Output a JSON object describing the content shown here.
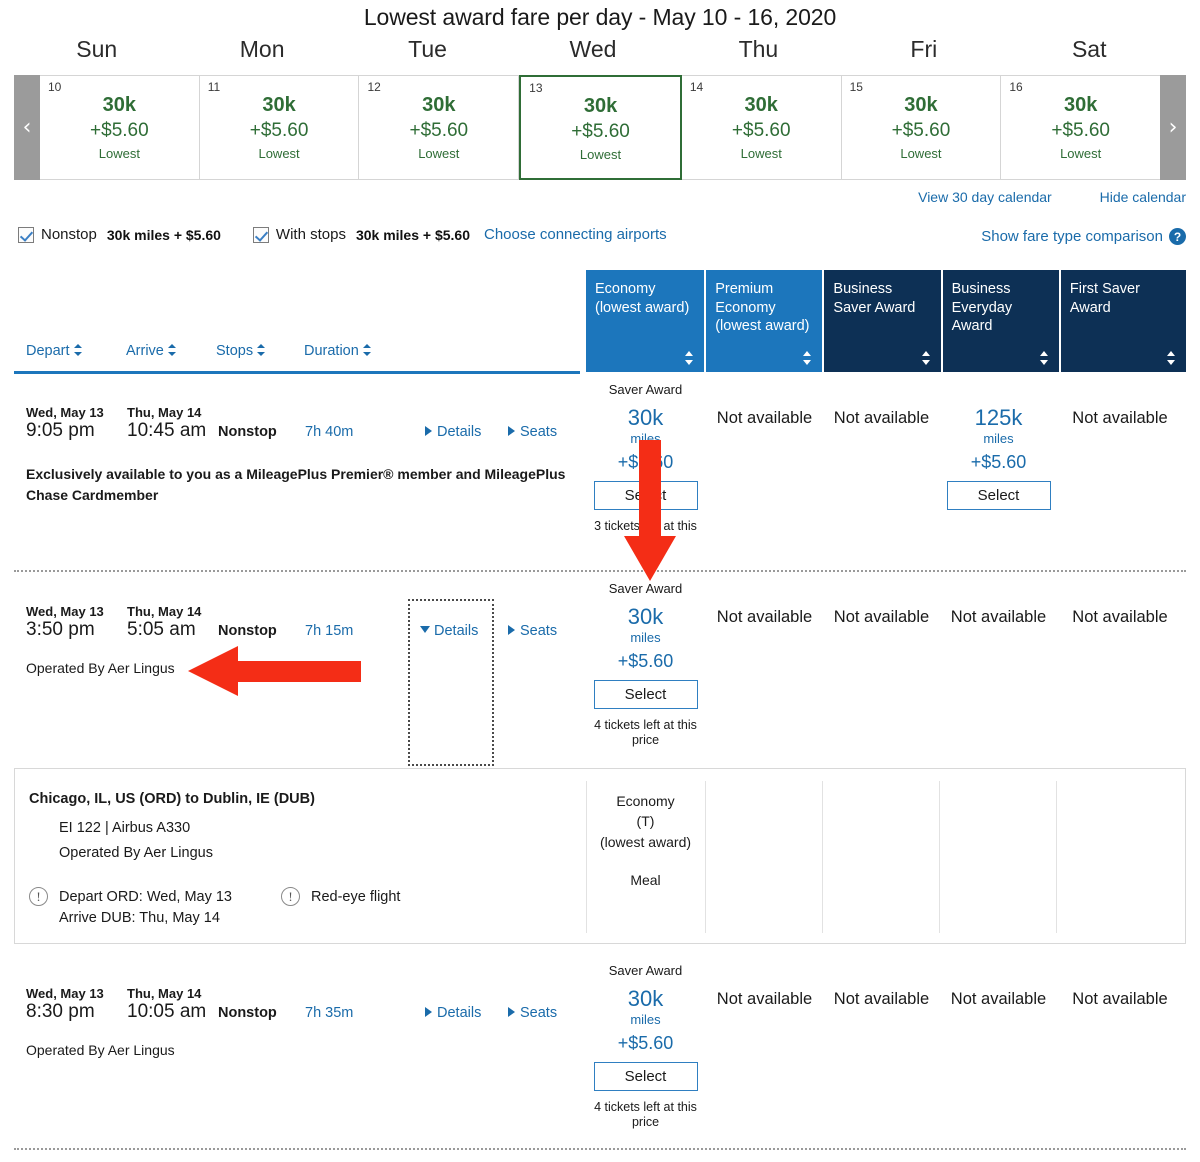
{
  "calendar": {
    "title": "Lowest award fare per day - May 10 - 16, 2020",
    "prev_label": "‹",
    "next_label": "›",
    "dow": [
      "Sun",
      "Mon",
      "Tue",
      "Wed",
      "Thu",
      "Fri",
      "Sat"
    ],
    "days": [
      {
        "num": "10",
        "miles": "30k",
        "fee": "+$5.60",
        "tag": "Lowest",
        "selected": false
      },
      {
        "num": "11",
        "miles": "30k",
        "fee": "+$5.60",
        "tag": "Lowest",
        "selected": false
      },
      {
        "num": "12",
        "miles": "30k",
        "fee": "+$5.60",
        "tag": "Lowest",
        "selected": false
      },
      {
        "num": "13",
        "miles": "30k",
        "fee": "+$5.60",
        "tag": "Lowest",
        "selected": true
      },
      {
        "num": "14",
        "miles": "30k",
        "fee": "+$5.60",
        "tag": "Lowest",
        "selected": false
      },
      {
        "num": "15",
        "miles": "30k",
        "fee": "+$5.60",
        "tag": "Lowest",
        "selected": false
      },
      {
        "num": "16",
        "miles": "30k",
        "fee": "+$5.60",
        "tag": "Lowest",
        "selected": false
      }
    ],
    "view_30_day": "View 30 day calendar",
    "hide_calendar": "Hide calendar",
    "accent_green": "#2f6d36"
  },
  "filters": {
    "nonstop_label": "Nonstop",
    "nonstop_value": "30k miles + $5.60",
    "with_stops_label": "With stops",
    "with_stops_value": "30k miles + $5.60",
    "choose_airports": "Choose connecting airports",
    "fare_comparison": "Show fare type comparison",
    "help_icon": "?"
  },
  "table": {
    "sort_columns": [
      {
        "label": "Depart"
      },
      {
        "label": "Arrive"
      },
      {
        "label": "Stops"
      },
      {
        "label": "Duration"
      }
    ],
    "fare_columns": [
      {
        "label": "Economy (lowest award)",
        "style": "light"
      },
      {
        "label": "Premium Economy (lowest award)",
        "style": "light"
      },
      {
        "label": "Business Saver Award",
        "style": "dark"
      },
      {
        "label": "Business Everyday Award",
        "style": "dark"
      },
      {
        "label": "First Saver Award",
        "style": "dark"
      }
    ],
    "header_light": "#1c76bc",
    "header_dark": "#0d3055"
  },
  "flights": [
    {
      "depart_date": "Wed, May 13",
      "depart_time": "9:05 pm",
      "arrive_date": "Thu, May 14",
      "arrive_time": "10:45 am",
      "stops": "Nonstop",
      "duration": "7h 40m",
      "details_label": "Details",
      "seats_label": "Seats",
      "note": "Exclusively available to you as a MileagePlus Premier® member and MileagePlus Chase Cardmember",
      "fares": [
        {
          "banner": "Saver Award",
          "miles": "30k",
          "miles_unit": "miles",
          "fee": "+$5.60",
          "button": "Select",
          "seats_left": "3 tickets left at this price"
        },
        {
          "unavailable": "Not available"
        },
        {
          "unavailable": "Not available"
        },
        {
          "miles": "125k",
          "miles_unit": "miles",
          "fee": "+$5.60",
          "button": "Select"
        },
        {
          "unavailable": "Not available"
        }
      ]
    },
    {
      "depart_date": "Wed, May 13",
      "depart_time": "3:50 pm",
      "arrive_date": "Thu, May 14",
      "arrive_time": "5:05 am",
      "stops": "Nonstop",
      "duration": "7h 15m",
      "details_label": "Details",
      "details_expanded": true,
      "seats_label": "Seats",
      "note": "Operated By Aer Lingus",
      "fares": [
        {
          "banner": "Saver Award",
          "miles": "30k",
          "miles_unit": "miles",
          "fee": "+$5.60",
          "button": "Select",
          "seats_left": "4 tickets left at this price"
        },
        {
          "unavailable": "Not available"
        },
        {
          "unavailable": "Not available"
        },
        {
          "unavailable": "Not available"
        },
        {
          "unavailable": "Not available"
        }
      ]
    },
    {
      "depart_date": "Wed, May 13",
      "depart_time": "8:30 pm",
      "arrive_date": "Thu, May 14",
      "arrive_time": "10:05 am",
      "stops": "Nonstop",
      "duration": "7h 35m",
      "details_label": "Details",
      "seats_label": "Seats",
      "note": "Operated By Aer Lingus",
      "fares": [
        {
          "banner": "Saver Award",
          "miles": "30k",
          "miles_unit": "miles",
          "fee": "+$5.60",
          "button": "Select",
          "seats_left": "4 tickets left at this price"
        },
        {
          "unavailable": "Not available"
        },
        {
          "unavailable": "Not available"
        },
        {
          "unavailable": "Not available"
        },
        {
          "unavailable": "Not available"
        }
      ]
    }
  ],
  "detail_panel": {
    "route": "Chicago, IL, US (ORD) to Dublin, IE (DUB)",
    "flight": "EI 122 | Airbus A330",
    "operated_by": "Operated By Aer Lingus",
    "depart_note": "Depart ORD: Wed, May 13",
    "arrive_note": "Arrive DUB: Thu, May 14",
    "redeye_note": "Red-eye flight",
    "warn_icon": "!",
    "cabin": "Economy",
    "fare_class": "(T)",
    "cabin_note": "(lowest award)",
    "meal": "Meal"
  },
  "annotations": {
    "color": "#f42d16",
    "down_arrow": "down-arrow-to-economy-fare",
    "left_arrow": "left-arrow-to-operated-by"
  }
}
